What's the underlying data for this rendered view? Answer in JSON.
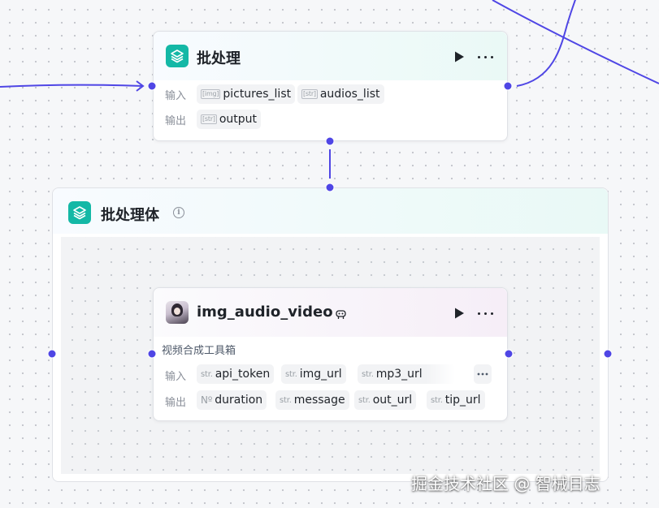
{
  "batch_node": {
    "title": "批处理",
    "input_label": "输入",
    "output_label": "输出",
    "inputs": [
      {
        "type": "[img]",
        "name": "pictures_list"
      },
      {
        "type": "[str]",
        "name": "audios_list"
      }
    ],
    "outputs": [
      {
        "type": "[str]",
        "name": "output"
      }
    ]
  },
  "batch_body": {
    "title": "批处理体",
    "info_icon": "info-icon"
  },
  "tool_node": {
    "title": "img_audio_video",
    "badge_icon": "plugin-badge-icon",
    "description": "视频合成工具箱",
    "input_label": "输入",
    "output_label": "输出",
    "inputs": [
      {
        "type": "str.",
        "name": "api_token"
      },
      {
        "type": "str.",
        "name": "img_url"
      },
      {
        "type": "str.",
        "name": "mp3_url"
      }
    ],
    "outputs": [
      {
        "type": "Nº",
        "name": "duration"
      },
      {
        "type": "str.",
        "name": "message"
      },
      {
        "type": "str.",
        "name": "out_url"
      },
      {
        "type": "str.",
        "name": "tip_url"
      }
    ]
  },
  "watermark": "掘金技术社区 @ 智械日志",
  "colors": {
    "edge": "#4f46e5",
    "teal_icon": "#14b8a6"
  }
}
